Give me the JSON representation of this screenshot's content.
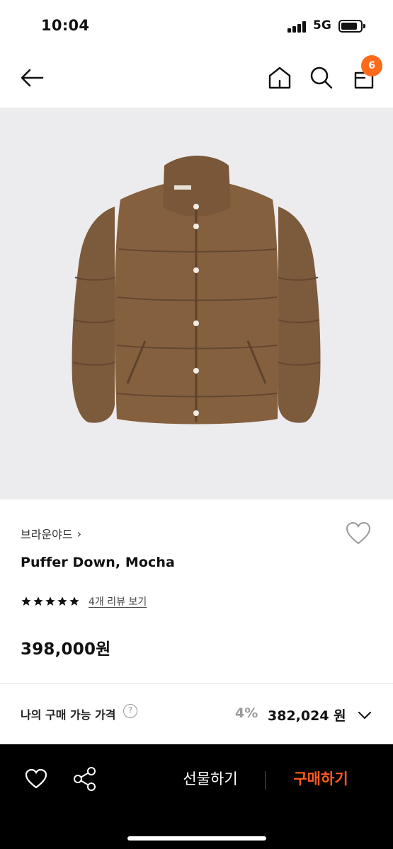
{
  "status_bar": {
    "time": "10:04",
    "network": "5G",
    "icons": [
      "signal-icon",
      "battery-icon"
    ]
  },
  "nav": {
    "icons": [
      "back-arrow-icon",
      "home-icon",
      "search-icon",
      "shopping-bag-icon"
    ],
    "cart_count": "6",
    "badge_color": "#ff6a1a"
  },
  "product": {
    "image_icon": "puffer-jacket-image",
    "brand": "브라운야드",
    "brand_chevron": "›",
    "name": "Puffer Down, Mocha",
    "rating_stars": 5,
    "review_link": "4개 리뷰 보기",
    "price": "398,000원"
  },
  "my_price": {
    "label": "나의 구매 가능 가격",
    "help": "?",
    "discount": "4%",
    "price": "382,024 원"
  },
  "bottom_bar": {
    "gift_label": "선물하기",
    "buy_label": "구매하기",
    "buy_color": "#ff5a1f",
    "icons": [
      "heart-icon",
      "share-icon"
    ]
  }
}
